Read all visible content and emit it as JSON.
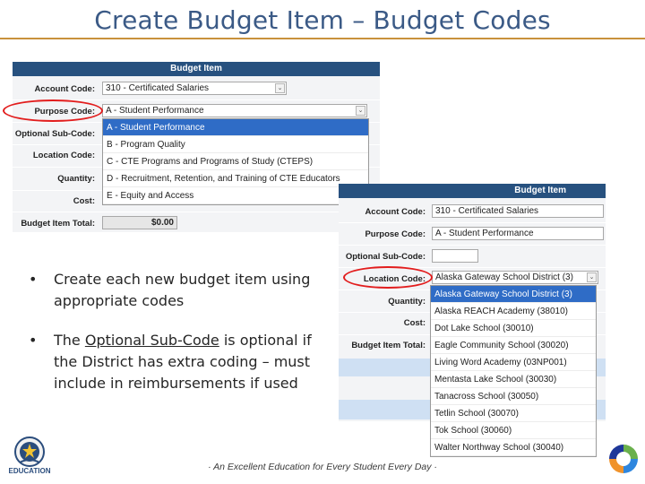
{
  "slide": {
    "title": "Create Budget Item – Budget Codes",
    "footer": "· An Excellent Education for Every Student Every Day ·",
    "logo_text": "EDUCATION"
  },
  "panel1": {
    "header": "Budget Item",
    "account_label": "Account Code:",
    "account_value": "310 - Certificated Salaries",
    "purpose_label": "Purpose Code:",
    "purpose_value": "A - Student Performance",
    "optional_label": "Optional Sub-Code:",
    "location_label": "Location Code:",
    "quantity_label": "Quantity:",
    "cost_label": "Cost:",
    "total_label": "Budget Item Total:",
    "total_value": "$0.00",
    "options": [
      "A - Student Performance",
      "B - Program Quality",
      "C - CTE Programs and Programs of Study (CTEPS)",
      "D - Recruitment, Retention, and Training of CTE Educators",
      "E - Equity and Access"
    ]
  },
  "panel2": {
    "header": "Budget Item",
    "account_label": "Account Code:",
    "account_value": "310 - Certificated Salaries",
    "purpose_label": "Purpose Code:",
    "purpose_value": "A - Student Performance",
    "optional_label": "Optional Sub-Code:",
    "location_label": "Location Code:",
    "location_value": "Alaska Gateway School District (3)",
    "quantity_label": "Quantity:",
    "cost_label": "Cost:",
    "total_label": "Budget Item Total:",
    "options": [
      "Alaska Gateway School District (3)",
      "Alaska REACH Academy (38010)",
      "Dot Lake School (30010)",
      "Eagle Community School (30020)",
      "Living Word Academy (03NP001)",
      "Mentasta Lake School (30030)",
      "Tanacross School (30050)",
      "Tetlin School (30070)",
      "Tok School (30060)",
      "Walter Northway School (30040)"
    ]
  },
  "bullets": {
    "b1": "Create each new budget item using appropriate codes",
    "b2_pre": "The ",
    "b2_link": "Optional Sub-Code",
    "b2_post": " is optional if the District has extra coding – must include in reimbursements if used"
  },
  "colors": {
    "panel_header": "#27517f",
    "selected_option": "#2f6cc6",
    "title": "#3b5a86",
    "rule": "#c8913c",
    "annotation": "#e21d1d"
  }
}
